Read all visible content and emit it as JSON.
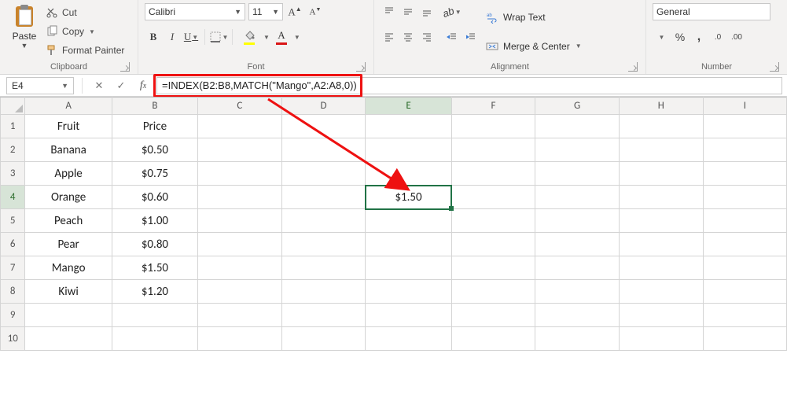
{
  "ribbon": {
    "clipboard": {
      "paste_label": "Paste",
      "cut_label": "Cut",
      "copy_label": "Copy",
      "format_painter_label": "Format Painter",
      "group_label": "Clipboard"
    },
    "font": {
      "font_name": "Calibri",
      "font_size": "11",
      "bold": "B",
      "italic": "I",
      "underline": "U",
      "font_color_char": "A",
      "fill_color_hex": "#ffff00",
      "font_color_hex": "#d91616",
      "group_label": "Font"
    },
    "alignment": {
      "wrap_text_label": "Wrap Text",
      "merge_center_label": "Merge & Center",
      "group_label": "Alignment"
    },
    "number": {
      "format_name": "General",
      "group_label": "Number"
    }
  },
  "name_box": "E4",
  "formula": "=INDEX(B2:B8,MATCH(\"Mango\",A2:A8,0))",
  "columns": [
    "A",
    "B",
    "C",
    "D",
    "E",
    "F",
    "G",
    "H",
    "I"
  ],
  "rows": [
    "1",
    "2",
    "3",
    "4",
    "5",
    "6",
    "7",
    "8",
    "9",
    "10"
  ],
  "cells": {
    "A1": "Fruit",
    "B1": "Price",
    "A2": "Banana",
    "B2": "$0.50",
    "A3": "Apple",
    "B3": "$0.75",
    "A4": "Orange",
    "B4": "$0.60",
    "A5": "Peach",
    "B5": "$1.00",
    "A6": "Pear",
    "B6": "$0.80",
    "A7": "Mango",
    "B7": "$1.50",
    "A8": "Kiwi",
    "B8": "$1.20",
    "E4": "$1.50"
  },
  "selected_cell": "E4"
}
